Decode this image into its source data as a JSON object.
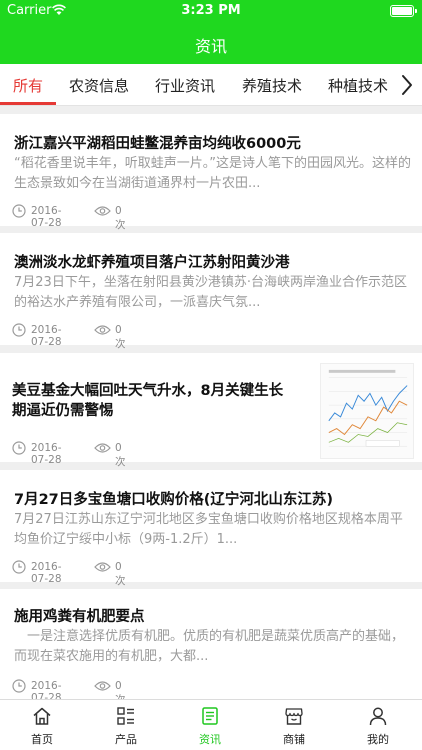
{
  "status_bar": {
    "carrier": "Carrier",
    "time": "3:23 PM"
  },
  "nav": {
    "title": "资讯"
  },
  "tabs": [
    {
      "label": "所有"
    },
    {
      "label": "农资信息"
    },
    {
      "label": "行业资讯"
    },
    {
      "label": "养殖技术"
    },
    {
      "label": "种植技术"
    }
  ],
  "articles": [
    {
      "title": "浙江嘉兴平湖稻田蛙鳖混养亩均纯收6000元",
      "summary": "“稻花香里说丰年，听取蛙声一片。”这是诗人笔下的田园风光。这样的生态景致如今在当湖街道通界村一片农田...",
      "date": "2016-07-28",
      "views": "0次"
    },
    {
      "title": "澳洲淡水龙虾养殖项目落户江苏射阳黄沙港",
      "summary": "7月23日下午，坐落在射阳县黄沙港镇苏·台海峡两岸渔业合作示范区的裕达水产养殖有限公司，一派喜庆气氛...",
      "date": "2016-07-28",
      "views": "0次"
    },
    {
      "title_line1": "美豆基金大幅回吐天气升水，8月关键生长",
      "title_line2": "期逼近仍需警惕",
      "date": "2016-07-28",
      "views": "0次"
    },
    {
      "title": "7月27日多宝鱼塘口收购价格(辽宁河北山东江苏)",
      "summary": "7月27日江苏山东辽宁河北地区多宝鱼塘口收购价格地区规格本周平均鱼价辽宁绥中小标（9两-1.2斤）1...",
      "date": "2016-07-28",
      "views": "0次"
    },
    {
      "title": "施用鸡粪有机肥要点",
      "summary": "　一是注意选择优质有机肥。优质的有机肥是蔬菜优质高产的基础，而现在菜农施用的有机肥，大都...",
      "date": "2016-07-28",
      "views": "0次"
    }
  ],
  "bottom_nav": [
    {
      "label": "首页",
      "icon": "home-icon"
    },
    {
      "label": "产品",
      "icon": "product-list-icon"
    },
    {
      "label": "资讯",
      "icon": "news-icon"
    },
    {
      "label": "商铺",
      "icon": "store-icon"
    },
    {
      "label": "我的",
      "icon": "user-icon"
    }
  ],
  "colors": {
    "brand_green": "#1fd81f",
    "active_tab_red": "#e53935"
  }
}
